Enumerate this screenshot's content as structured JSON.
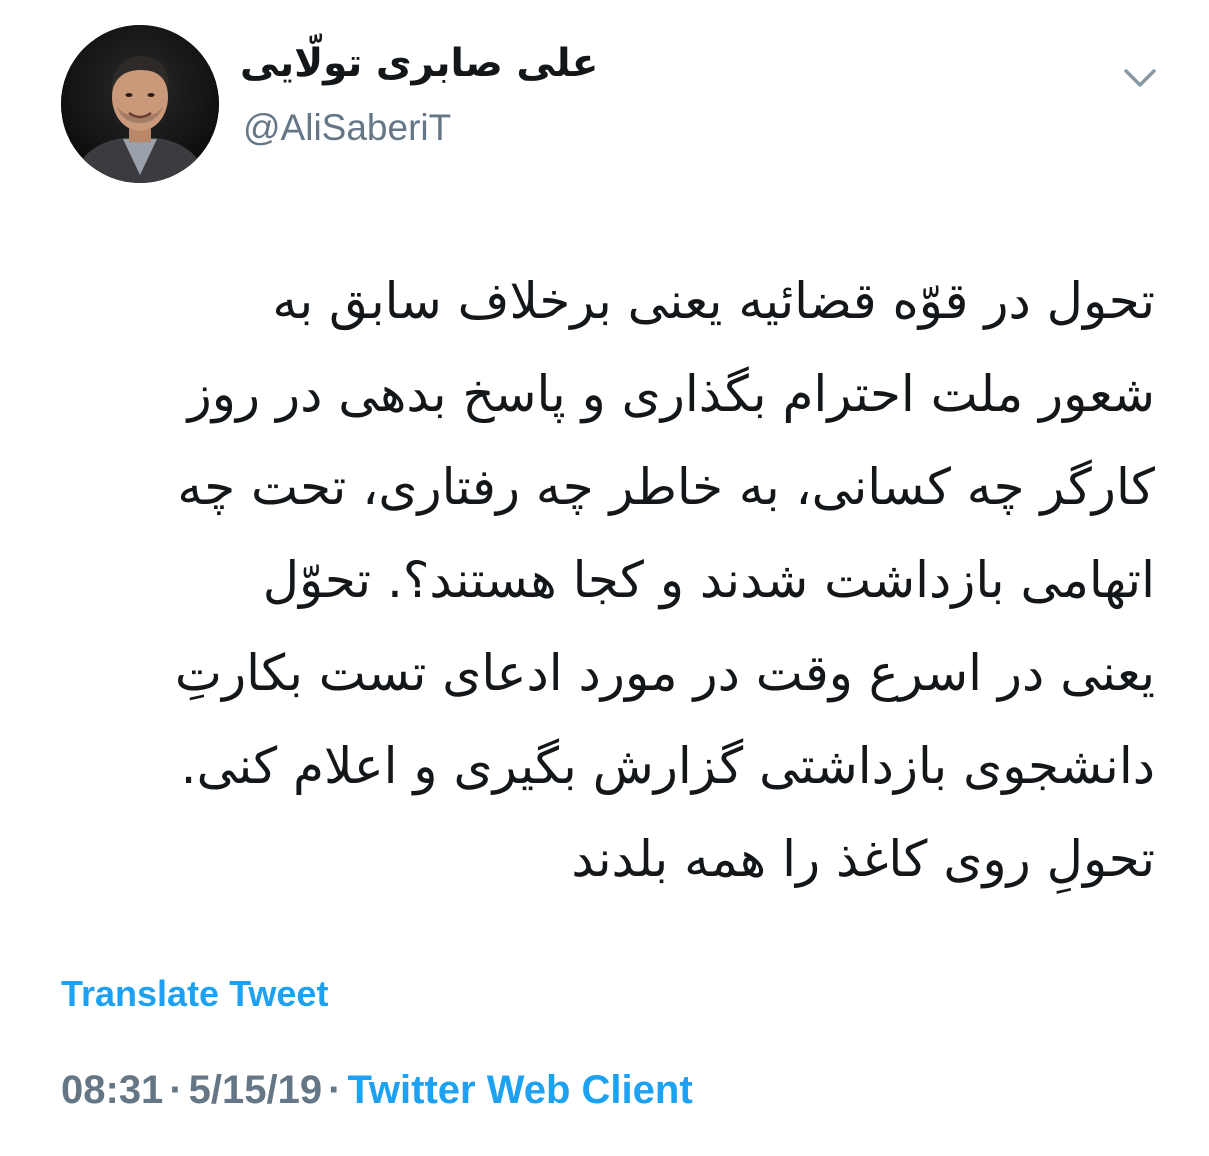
{
  "author": {
    "display_name": "علی صابری تولّایی",
    "handle": "@AliSaberiT",
    "avatar_icon": "person-portrait"
  },
  "menu": {
    "caret_icon": "chevron-down-icon"
  },
  "tweet": {
    "lines": [
      "تحول در قوّه قضائیه یعنی برخلاف سابق به",
      "شعور ملت احترام بگذاری و پاسخ بدهی در روز",
      "کارگر چه کسانی، به خاطر چه رفتاری، تحت چه",
      "اتهامی بازداشت شدند و کجا هستند؟. تحوّل",
      "یعنی در اسرع وقت در مورد ادعای تست بکارتِ",
      "دانشجوی بازداشتی گزارش بگیری و اعلام کنی.",
      "تحولِ روی کاغذ را همه بلدند"
    ]
  },
  "actions": {
    "translate_label": "Translate Tweet"
  },
  "meta": {
    "time": "08:31",
    "separator": "·",
    "date": "5/15/19",
    "client": "Twitter Web Client"
  },
  "colors": {
    "accent": "#1da1f2",
    "secondary_text": "#657786",
    "primary_text": "#14171a"
  }
}
